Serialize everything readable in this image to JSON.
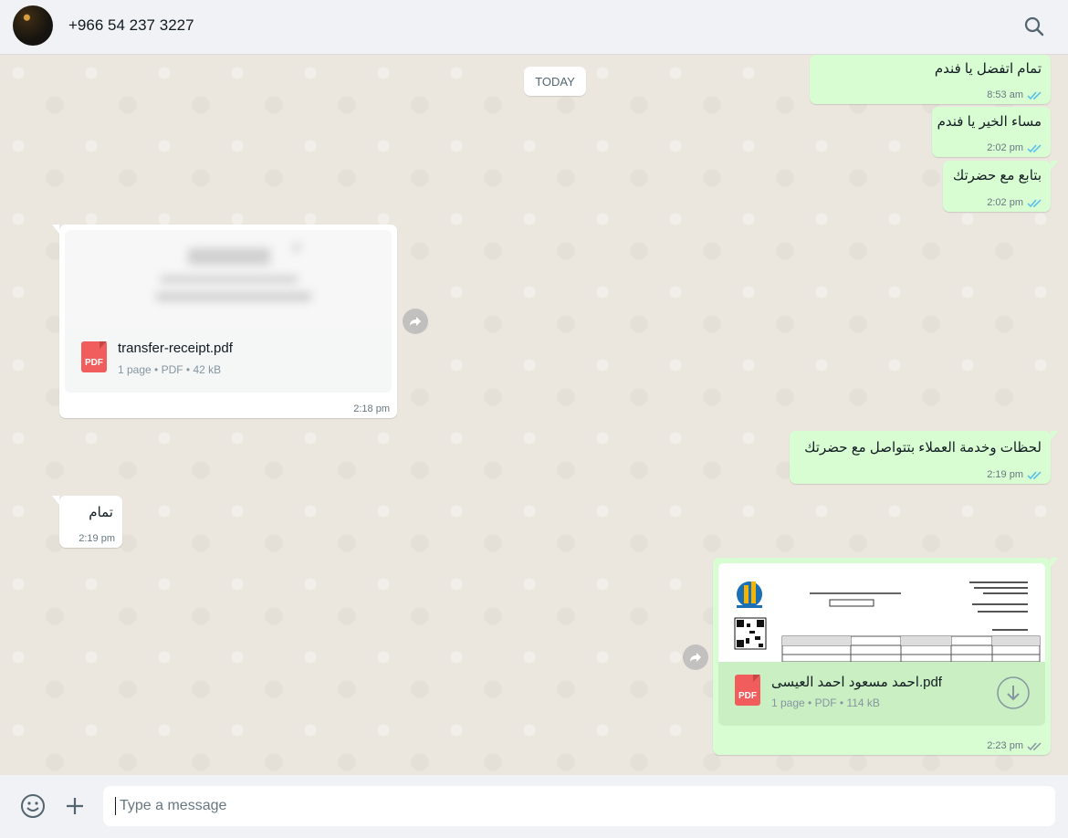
{
  "header": {
    "contact_name": "+966 54 237 3227",
    "search_icon": "search-icon"
  },
  "chat": {
    "day_label": "TODAY",
    "messages": [
      {
        "text": "تمام اتفضل يا فندم",
        "time": "8:53 am",
        "status": "read"
      },
      {
        "text": "مساء الخير يا فندم",
        "time": "2:02 pm",
        "status": "read"
      },
      {
        "text": "بتابع مع حضرتك",
        "time": "2:02 pm",
        "status": "read"
      },
      {
        "file_name": "transfer-receipt.pdf",
        "file_info": "1 page • PDF • 42 kB",
        "time": "2:18 pm"
      },
      {
        "text": "لحظات وخدمة العملاء بتتواصل مع حضرتك",
        "time": "2:19 pm",
        "status": "read"
      },
      {
        "text": "تمام",
        "time": "2:19 pm"
      },
      {
        "file_name": "احمد مسعود احمد العيسى.pdf",
        "file_info": "1 page • PDF • 114 kB",
        "time": "2:23 pm",
        "status": "delivered"
      }
    ],
    "pdf_badge": "PDF"
  },
  "footer": {
    "placeholder": "Type a message",
    "emoji_icon": "emoji-icon",
    "attach_icon": "plus-icon"
  },
  "colors": {
    "outgoing_bubble": "#d9fdd3",
    "incoming_bubble": "#ffffff",
    "read_ticks": "#53bdeb",
    "delivered_ticks": "#8696a0",
    "pdf_red": "#f15c5c"
  }
}
